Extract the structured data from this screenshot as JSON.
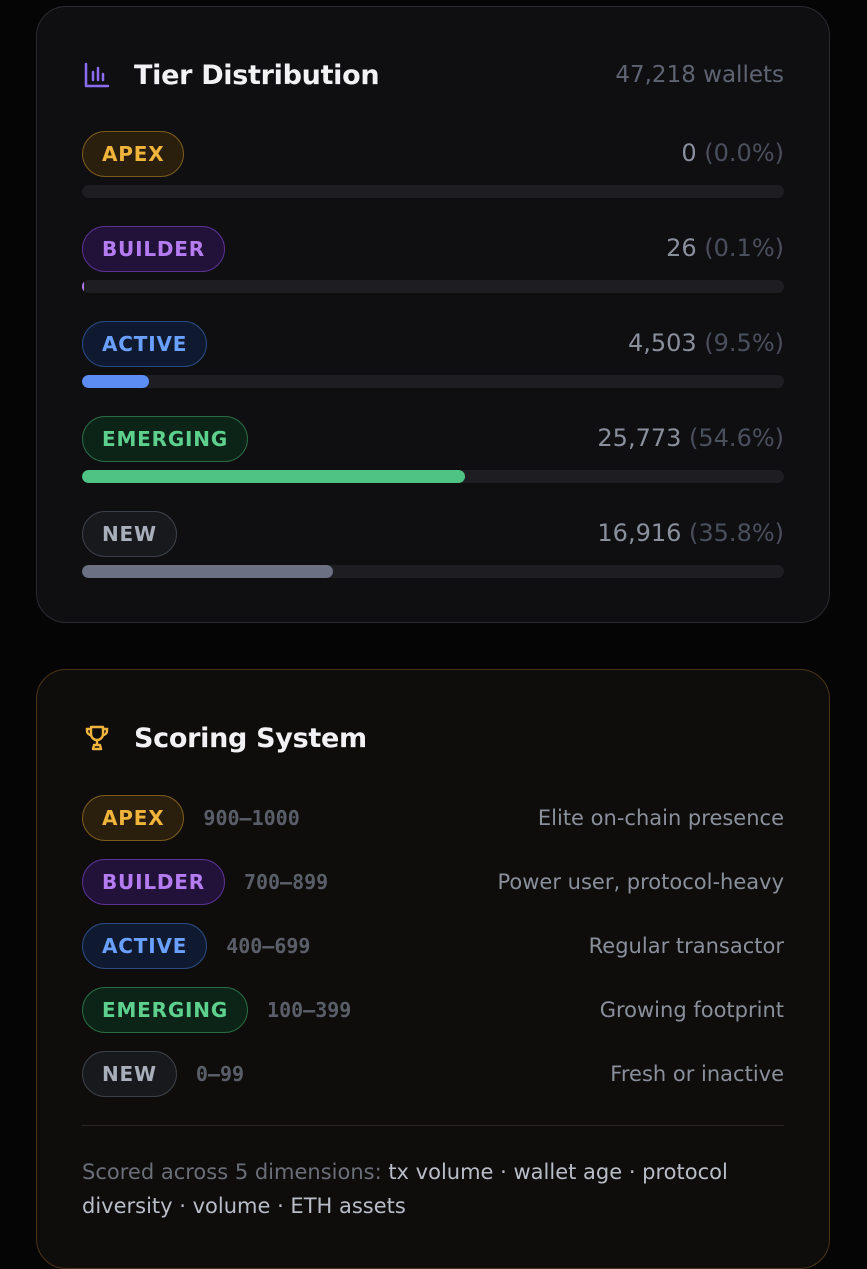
{
  "distribution": {
    "title": "Tier Distribution",
    "total": "47,218 wallets",
    "icon": "bar-chart-icon",
    "tiers": [
      {
        "key": "apex",
        "label": "APEX",
        "count": "0",
        "pct": "(0.0%)",
        "fraction": 0.0,
        "color": "#f0b43c"
      },
      {
        "key": "builder",
        "label": "BUILDER",
        "count": "26",
        "pct": "(0.1%)",
        "fraction": 0.001,
        "color": "#b47cf0"
      },
      {
        "key": "active",
        "label": "ACTIVE",
        "count": "4,503",
        "pct": "(9.5%)",
        "fraction": 0.095,
        "color": "#5b8df5"
      },
      {
        "key": "emerging",
        "label": "EMERGING",
        "count": "25,773",
        "pct": "(54.6%)",
        "fraction": 0.546,
        "color": "#4fc384"
      },
      {
        "key": "new",
        "label": "NEW",
        "count": "16,916",
        "pct": "(35.8%)",
        "fraction": 0.358,
        "color": "#6b7182"
      }
    ]
  },
  "scoring": {
    "title": "Scoring System",
    "icon": "trophy-icon",
    "tiers": [
      {
        "key": "apex",
        "label": "APEX",
        "range": "900–1000",
        "desc": "Elite on-chain presence"
      },
      {
        "key": "builder",
        "label": "BUILDER",
        "range": "700–899",
        "desc": "Power user, protocol-heavy"
      },
      {
        "key": "active",
        "label": "ACTIVE",
        "range": "400–699",
        "desc": "Regular transactor"
      },
      {
        "key": "emerging",
        "label": "EMERGING",
        "range": "100–399",
        "desc": "Growing footprint"
      },
      {
        "key": "new",
        "label": "NEW",
        "range": "0–99",
        "desc": "Fresh or inactive"
      }
    ],
    "footnote_prefix": "Scored across 5 dimensions: ",
    "footnote_dims": "tx volume · wallet age · protocol diversity · volume · ETH assets"
  }
}
